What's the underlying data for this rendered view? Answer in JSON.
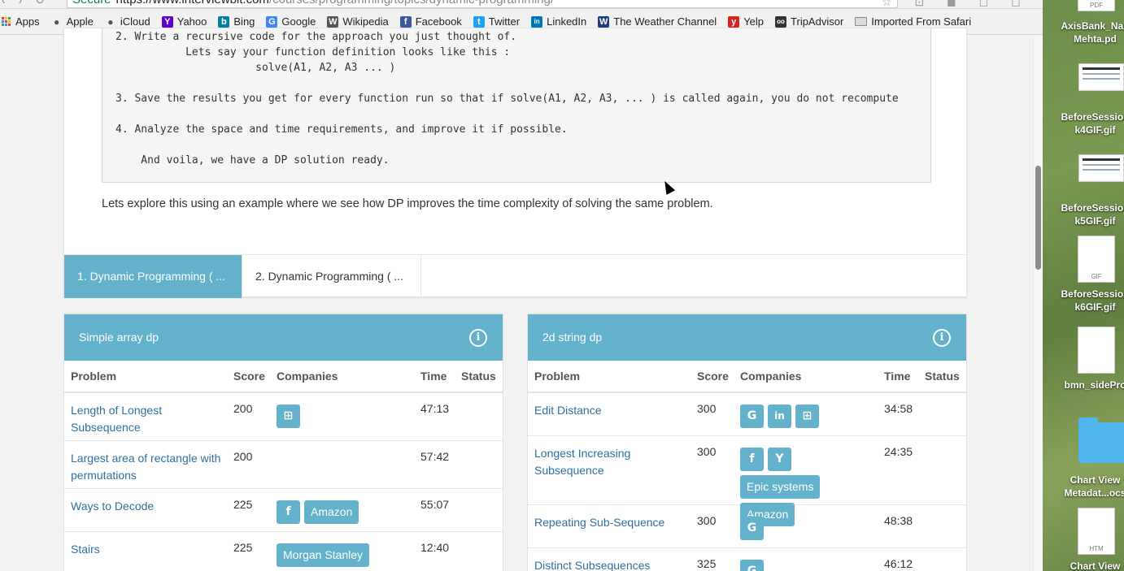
{
  "browser": {
    "secure_label": "Secure",
    "url_host": "https://www.interviewbit.com",
    "url_path": "/courses/programming/topics/dynamic-programming/"
  },
  "bookmarks": [
    {
      "label": "Apps",
      "icon": "apps-grid-icon"
    },
    {
      "label": "Apple",
      "icon": "apple-icon"
    },
    {
      "label": "iCloud",
      "icon": "apple-icon"
    },
    {
      "label": "Yahoo",
      "icon": "yahoo-icon",
      "glyph": "Y",
      "color": "#5f01d1"
    },
    {
      "label": "Bing",
      "icon": "bing-icon",
      "glyph": "b",
      "color": "#00809d"
    },
    {
      "label": "Google",
      "icon": "google-icon",
      "glyph": "G",
      "color": "#4285f4"
    },
    {
      "label": "Wikipedia",
      "icon": "wikipedia-icon",
      "glyph": "W",
      "color": "#555555"
    },
    {
      "label": "Facebook",
      "icon": "facebook-icon",
      "glyph": "f",
      "color": "#3b5998"
    },
    {
      "label": "Twitter",
      "icon": "twitter-icon",
      "glyph": "t",
      "color": "#1da1f2"
    },
    {
      "label": "LinkedIn",
      "icon": "linkedin-icon",
      "glyph": "in",
      "color": "#0077b5"
    },
    {
      "label": "The Weather Channel",
      "icon": "weather-channel-icon",
      "glyph": "W",
      "color": "#1f3e7a"
    },
    {
      "label": "Yelp",
      "icon": "yelp-icon",
      "glyph": "y",
      "color": "#d32323"
    },
    {
      "label": "TripAdvisor",
      "icon": "tripadvisor-icon",
      "glyph": "oo",
      "color": "#333333"
    },
    {
      "label": "Imported From Safari",
      "icon": "folder-icon"
    }
  ],
  "article": {
    "code_lines": [
      "2. Write a recursive code for the approach you just thought of.",
      "           Lets say your function definition looks like this :",
      "                      solve(A1, A2, A3 ... )",
      "",
      "3. Save the results you get for every function run so that if solve(A1, A2, A3, ... ) is called again, you do not recompute",
      "",
      "4. Analyze the space and time requirements, and improve it if possible.",
      "",
      "    And voila, we have a DP solution ready."
    ],
    "lead_text": "Lets explore this using an example where we see how DP improves the time complexity of solving the same problem."
  },
  "tabs": [
    {
      "label": "1. Dynamic Programming ( ...",
      "active": true
    },
    {
      "label": "2. Dynamic Programming ( ...",
      "active": false
    }
  ],
  "columns": {
    "problem": "Problem",
    "score": "Score",
    "companies": "Companies",
    "time": "Time",
    "status": "Status"
  },
  "panels": [
    {
      "title": "Simple array dp",
      "rows": [
        {
          "problem": "Length of Longest Subsequence",
          "score": "200",
          "time": "47:13",
          "companies": [
            {
              "kind": "icon",
              "glyph": "⊞",
              "name": "microsoft-icon"
            }
          ]
        },
        {
          "problem": "Largest area of rectangle with permutations",
          "score": "200",
          "time": "57:42",
          "companies": []
        },
        {
          "problem": "Ways to Decode",
          "score": "225",
          "time": "55:07",
          "companies": [
            {
              "kind": "icon",
              "glyph": "f",
              "name": "facebook-icon"
            },
            {
              "kind": "text",
              "label": "Amazon"
            }
          ]
        },
        {
          "problem": "Stairs",
          "score": "225",
          "time": "12:40",
          "companies": [
            {
              "kind": "text",
              "label": "Morgan Stanley"
            }
          ]
        }
      ]
    },
    {
      "title": "2d string dp",
      "rows": [
        {
          "problem": "Edit Distance",
          "score": "300",
          "time": "34:58",
          "companies": [
            {
              "kind": "icon",
              "glyph": "G",
              "name": "google-icon"
            },
            {
              "kind": "icon",
              "glyph": "in",
              "name": "linkedin-icon"
            },
            {
              "kind": "icon",
              "glyph": "⊞",
              "name": "microsoft-icon"
            }
          ]
        },
        {
          "problem": "Longest Increasing Subsequence",
          "score": "300",
          "time": "24:35",
          "companies": [
            {
              "kind": "icon",
              "glyph": "f",
              "name": "facebook-icon"
            },
            {
              "kind": "icon",
              "glyph": "Y",
              "name": "yahoo-icon"
            },
            {
              "kind": "text",
              "label": "Epic systems"
            },
            {
              "kind": "text",
              "label": "Amazon"
            }
          ]
        },
        {
          "problem": "Repeating Sub-Sequence",
          "score": "300",
          "time": "48:38",
          "companies": [
            {
              "kind": "icon",
              "glyph": "G",
              "name": "google-icon"
            }
          ]
        },
        {
          "problem": "Distinct Subsequences",
          "score": "325",
          "time": "46:12",
          "companies": [
            {
              "kind": "icon",
              "glyph": "G",
              "name": "google-icon"
            }
          ]
        }
      ]
    }
  ],
  "desktop": [
    {
      "label1": "AxisBank_Nan",
      "label2": "Mehta.pd",
      "kind": "pdf"
    },
    {
      "label1": "BeforeSession",
      "label2": "k4GIF.gif",
      "kind": "shot"
    },
    {
      "label1": "BeforeSession",
      "label2": "k5GIF.gif",
      "kind": "shot"
    },
    {
      "label1": "BeforeSession",
      "label2": "k6GIF.gif",
      "kind": "gif"
    },
    {
      "label1": "bmn_sidePro",
      "label2": "",
      "kind": "blank"
    },
    {
      "label1": "Chart View",
      "label2": "Metadat...ocs",
      "kind": "folder"
    },
    {
      "label1": "Chart View",
      "label2": "",
      "kind": "htm"
    }
  ],
  "desktop_badges": {
    "pdf": "PDF",
    "gif": "GIF",
    "htm": "HTM"
  }
}
